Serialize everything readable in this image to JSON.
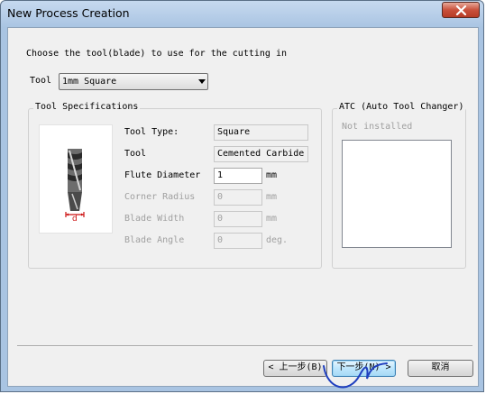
{
  "window": {
    "title": "New Process Creation"
  },
  "instruction": "Choose the tool(blade) to use for the cutting in",
  "tool_select": {
    "label": "Tool",
    "value": "1mm Square"
  },
  "tool_specifications": {
    "group_title": "Tool Specifications",
    "diagram_label": "d",
    "rows": [
      {
        "label": "Tool Type:",
        "value": "Square",
        "unit": "",
        "enabled": true
      },
      {
        "label": "Tool",
        "value": "Cemented Carbide",
        "unit": "",
        "enabled": true
      },
      {
        "label": "Flute Diameter",
        "value": "1",
        "unit": "mm",
        "enabled": true
      },
      {
        "label": "Corner Radius",
        "value": "0",
        "unit": "mm",
        "enabled": false
      },
      {
        "label": "Blade Width",
        "value": "0",
        "unit": "mm",
        "enabled": false
      },
      {
        "label": "Blade Angle",
        "value": "0",
        "unit": "deg.",
        "enabled": false
      }
    ]
  },
  "atc": {
    "group_title": "ATC (Auto Tool Changer)",
    "status": "Not installed"
  },
  "buttons": {
    "back": "< 上一步(B)",
    "next": "下一步(N) >",
    "cancel": "取消"
  },
  "colors": {
    "title_bar": "#a9c4e2",
    "close_button": "#c9503b",
    "dialog_background": "#f0f0f0",
    "annotation_scribble": "#1f3fbf",
    "diagram_accent": "#cc1111"
  }
}
